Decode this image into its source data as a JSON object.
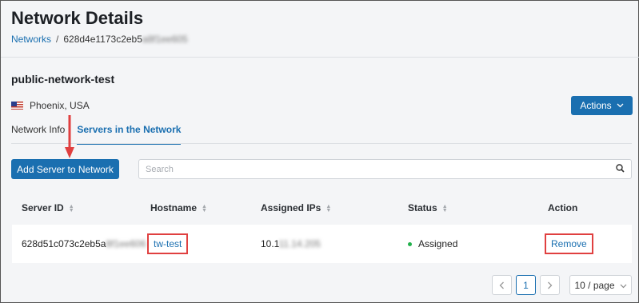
{
  "page": {
    "title": "Network Details"
  },
  "breadcrumb": {
    "root": "Networks",
    "separator": "/",
    "current_visible": "628d4e1173c2eb5",
    "current_blurred": "a8f1ee605"
  },
  "network": {
    "name": "public-network-test",
    "location": "Phoenix, USA",
    "flag_icon": "us-flag-icon"
  },
  "actions_button": {
    "label": "Actions",
    "icon": "chevron-down-icon"
  },
  "tabs": [
    {
      "label": "Network Info",
      "active": false
    },
    {
      "label": "Servers in the Network",
      "active": true
    }
  ],
  "add_server_button": {
    "label": "Add Server to Network"
  },
  "search": {
    "placeholder": "Search",
    "value": "",
    "icon": "search-icon"
  },
  "table": {
    "columns": [
      "Server ID",
      "Hostname",
      "Assigned IPs",
      "Status",
      "Action"
    ],
    "rows": [
      {
        "server_id_visible": "628d51c073c2eb5a",
        "server_id_blurred": "8f1ee606",
        "hostname": "tw-test",
        "ip_visible": "10.1",
        "ip_blurred": "11.14.205",
        "status": "Assigned",
        "action": "Remove"
      }
    ]
  },
  "pagination": {
    "prev_icon": "chevron-left-icon",
    "current_page": "1",
    "next_icon": "chevron-right-icon",
    "page_size": "10 / page"
  },
  "colors": {
    "accent": "#1a6fb0",
    "highlight": "#e04040",
    "status_assigned": "#21b04b"
  }
}
